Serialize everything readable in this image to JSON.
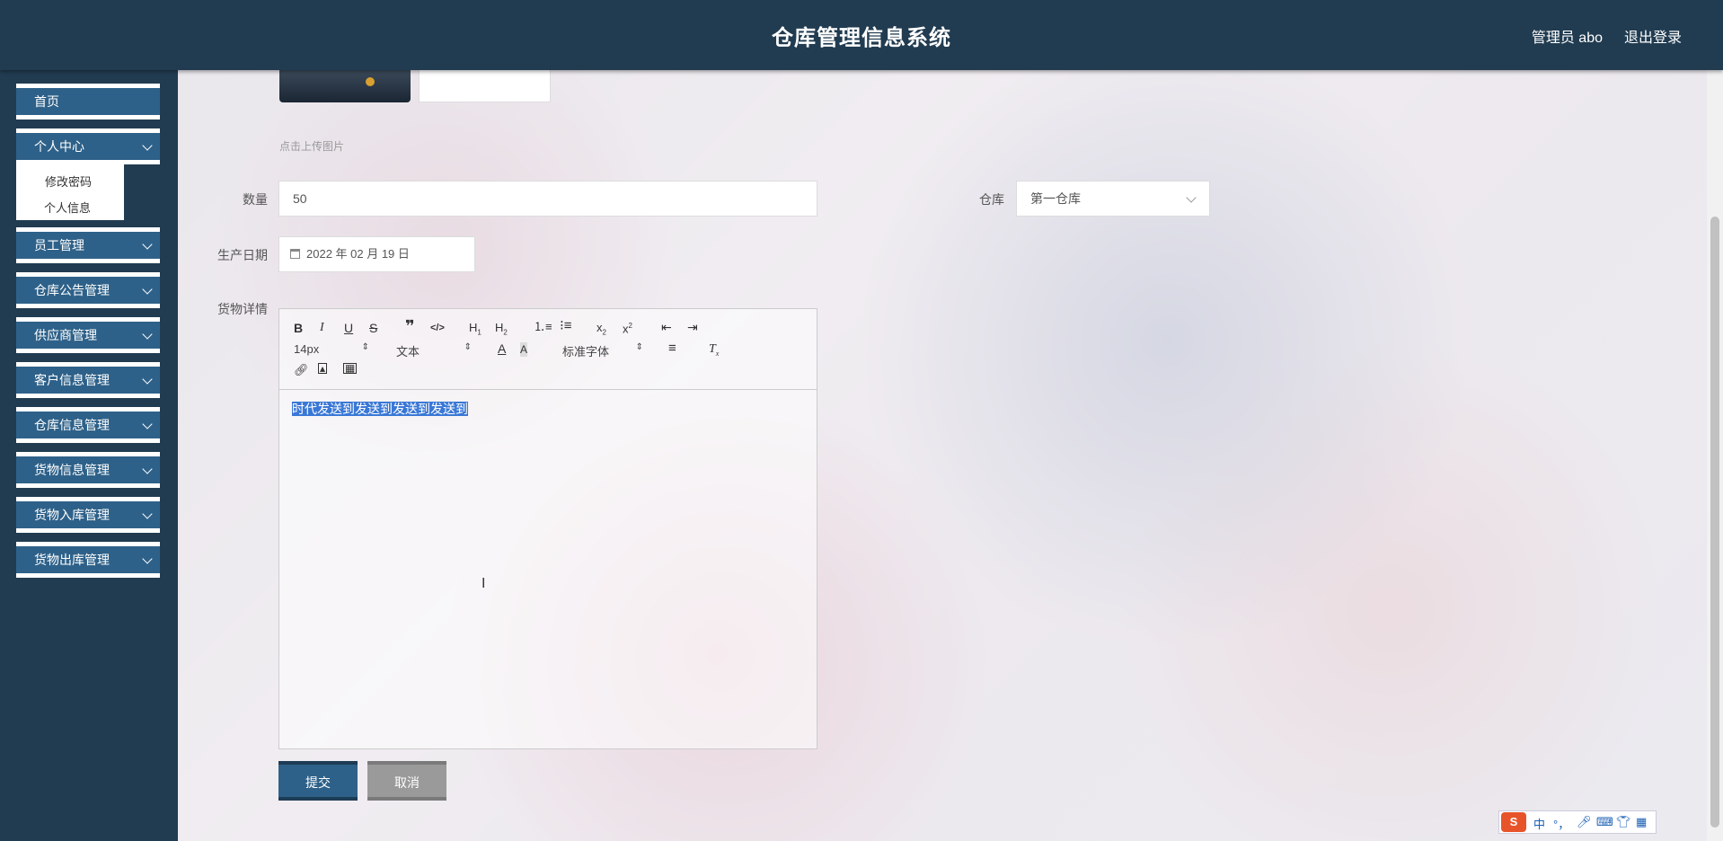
{
  "header": {
    "title": "仓库管理信息系统",
    "user": "管理员 abo",
    "logout": "退出登录"
  },
  "sidebar": {
    "items": [
      {
        "label": "首页"
      },
      {
        "label": "个人中心"
      },
      {
        "label": "员工管理"
      },
      {
        "label": "仓库公告管理"
      },
      {
        "label": "供应商管理"
      },
      {
        "label": "客户信息管理"
      },
      {
        "label": "仓库信息管理"
      },
      {
        "label": "货物信息管理"
      },
      {
        "label": "货物入库管理"
      },
      {
        "label": "货物出库管理"
      }
    ],
    "submenu": [
      {
        "label": "修改密码"
      },
      {
        "label": "个人信息"
      }
    ]
  },
  "form": {
    "upload_hint": "点击上传图片",
    "quantity_label": "数量",
    "quantity_value": "50",
    "warehouse_label": "仓库",
    "warehouse_value": "第一仓库",
    "date_label": "生产日期",
    "date_value": "2022 年 02 月 19 日",
    "details_label": "货物详情"
  },
  "editor": {
    "font_size": "14px",
    "block_type": "文本",
    "font_family": "标准字体",
    "content": "时代发送到发送到发送到发送到"
  },
  "buttons": {
    "submit": "提交",
    "cancel": "取消"
  },
  "ime": {
    "mode": "中",
    "punct": "°，"
  }
}
